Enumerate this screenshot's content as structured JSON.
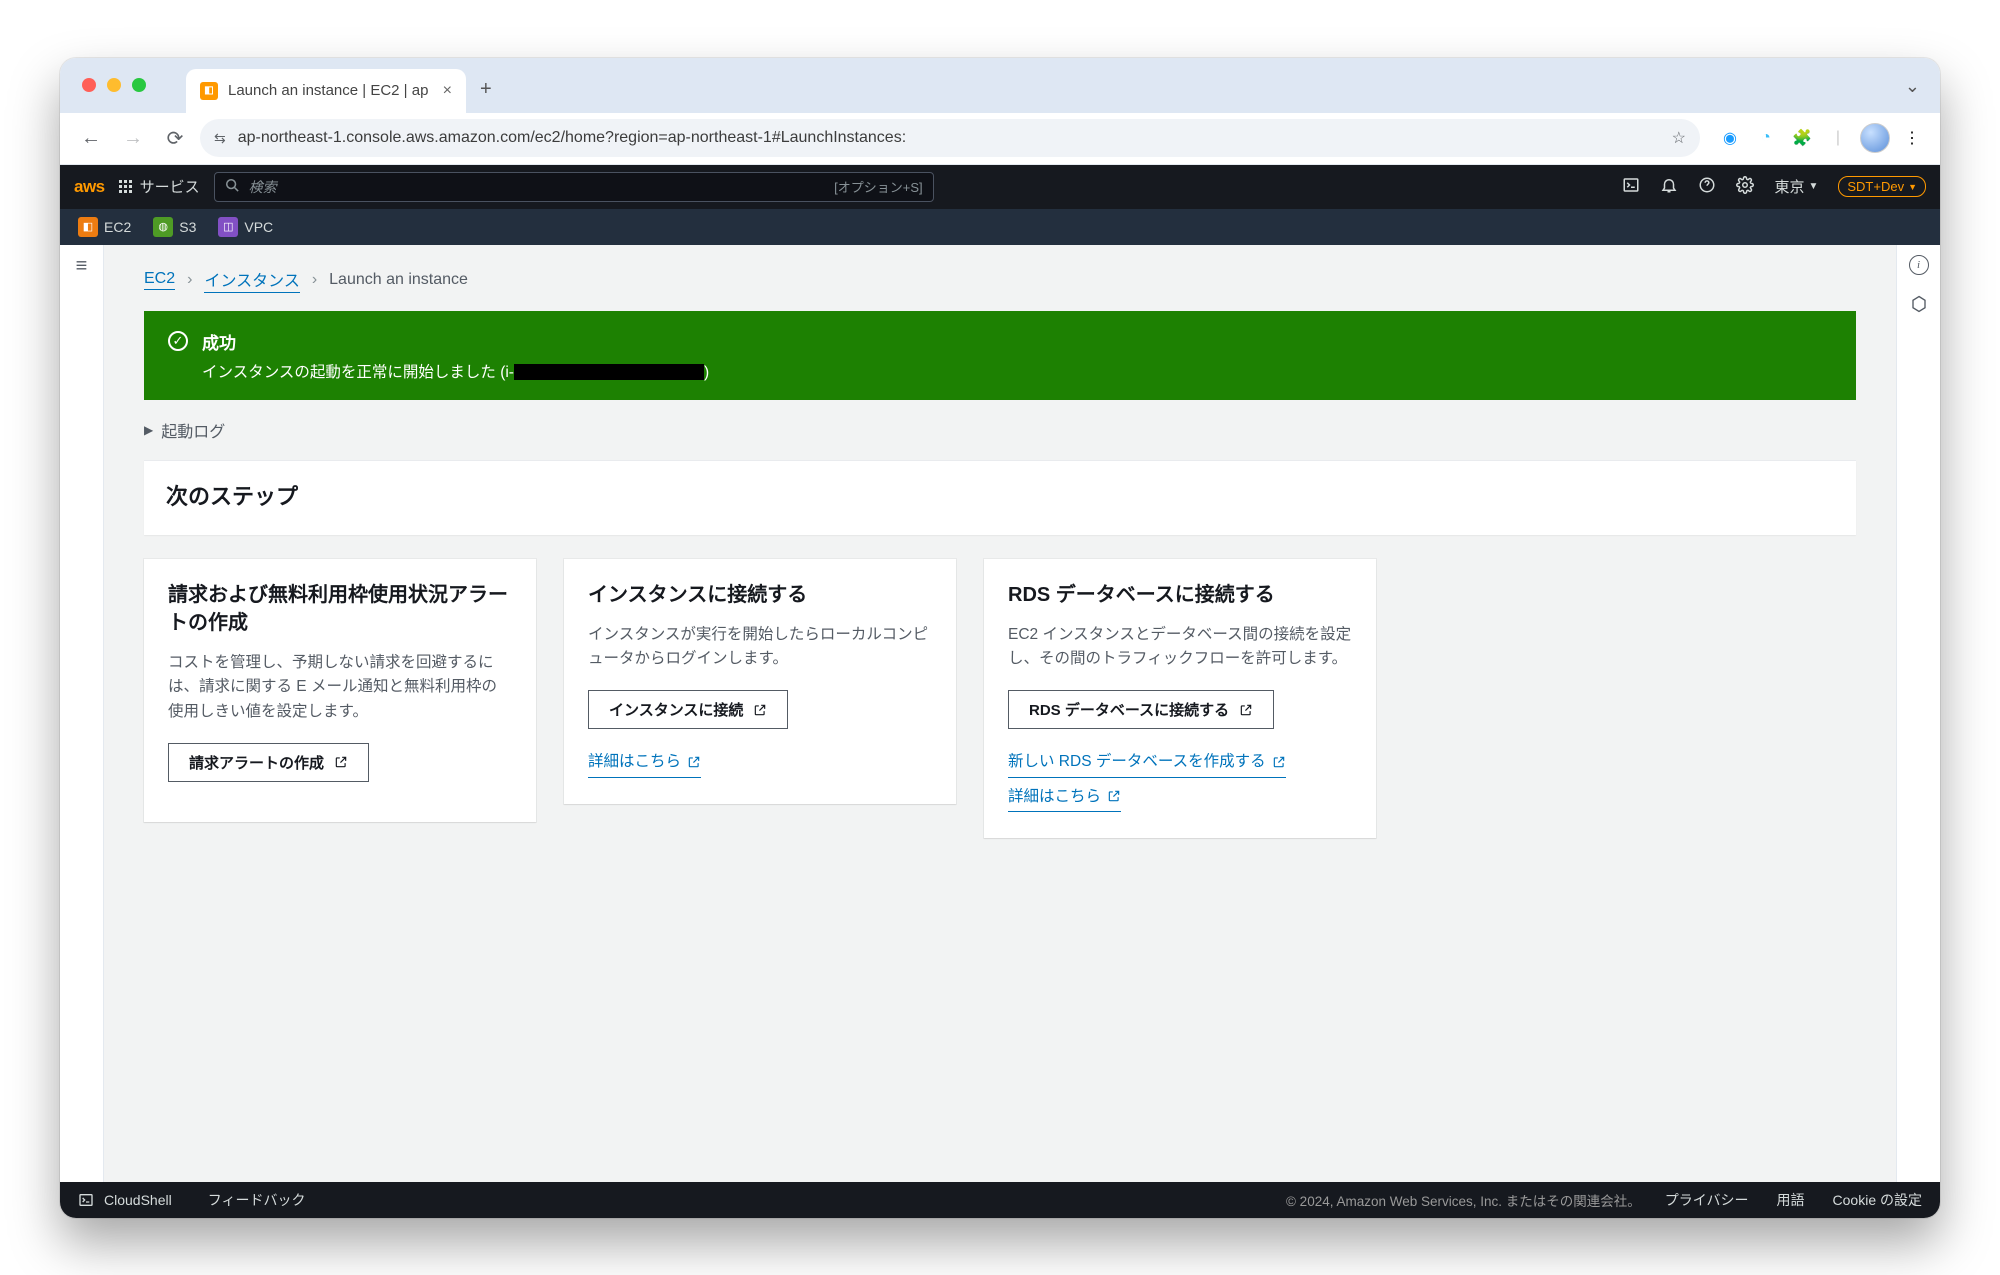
{
  "browser": {
    "tab_title": "Launch an instance | EC2 | ap",
    "url": "ap-northeast-1.console.aws.amazon.com/ec2/home?region=ap-northeast-1#LaunchInstances:"
  },
  "header": {
    "services": "サービス",
    "search_placeholder": "検索",
    "search_shortcut": "[オプション+S]",
    "region": "東京",
    "account": "SDT+Dev"
  },
  "favorites": [
    {
      "label": "EC2"
    },
    {
      "label": "S3"
    },
    {
      "label": "VPC"
    }
  ],
  "breadcrumb": {
    "root": "EC2",
    "mid": "インスタンス",
    "leaf": "Launch an instance"
  },
  "alert": {
    "title": "成功",
    "msg_prefix": "インスタンスの起動を正常に開始しました (i-",
    "msg_suffix": ")"
  },
  "launch_log": "起動ログ",
  "next_steps_title": "次のステップ",
  "cards": {
    "billing": {
      "title": "請求および無料利用枠使用状況アラートの作成",
      "desc": "コストを管理し、予期しない請求を回避するには、請求に関する E メール通知と無料利用枠の使用しきい値を設定します。",
      "button": "請求アラートの作成"
    },
    "connect": {
      "title": "インスタンスに接続する",
      "desc": "インスタンスが実行を開始したらローカルコンピュータからログインします。",
      "button": "インスタンスに接続",
      "link": "詳細はこちら"
    },
    "rds": {
      "title": "RDS データベースに接続する",
      "desc": "EC2 インスタンスとデータベース間の接続を設定し、その間のトラフィックフローを許可します。",
      "button": "RDS データベースに接続する",
      "link1": "新しい RDS データベースを作成する",
      "link2": "詳細はこちら"
    }
  },
  "footer": {
    "cloudshell": "CloudShell",
    "feedback": "フィードバック",
    "copyright": "© 2024, Amazon Web Services, Inc. またはその関連会社。",
    "privacy": "プライバシー",
    "terms": "用語",
    "cookie": "Cookie の設定"
  }
}
